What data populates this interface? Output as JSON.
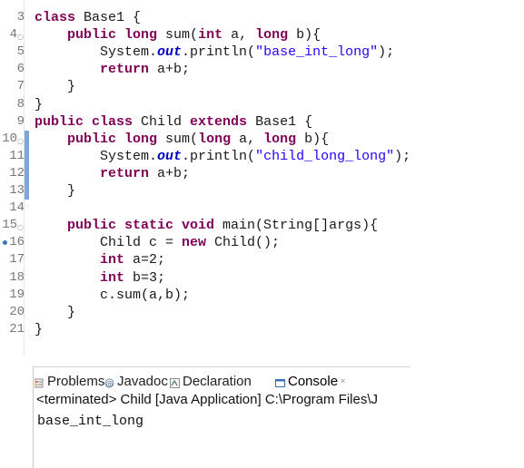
{
  "editor": {
    "lines": [
      {
        "num": "3",
        "segments": [
          [
            "kw",
            "class"
          ],
          [
            "",
            " Base1 {"
          ]
        ]
      },
      {
        "num": "4",
        "fold": true,
        "segments": [
          [
            "",
            "    "
          ],
          [
            "kw",
            "public long"
          ],
          [
            "",
            " sum("
          ],
          [
            "kw",
            "int"
          ],
          [
            "",
            " a, "
          ],
          [
            "kw",
            "long"
          ],
          [
            "",
            " b){"
          ]
        ]
      },
      {
        "num": "5",
        "segments": [
          [
            "",
            "        System."
          ],
          [
            "fld",
            "out"
          ],
          [
            "",
            ".println("
          ],
          [
            "str",
            "\"base_int_long\""
          ],
          [
            "",
            ");"
          ]
        ]
      },
      {
        "num": "6",
        "segments": [
          [
            "",
            "        "
          ],
          [
            "kw",
            "return"
          ],
          [
            "",
            " a+b;"
          ]
        ]
      },
      {
        "num": "7",
        "segments": [
          [
            "",
            "    }"
          ]
        ]
      },
      {
        "num": "8",
        "segments": [
          [
            "",
            "}"
          ]
        ]
      },
      {
        "num": "9",
        "segments": [
          [
            "kw",
            "public class"
          ],
          [
            "",
            " Child "
          ],
          [
            "kw",
            "extends"
          ],
          [
            "",
            " Base1 {"
          ]
        ]
      },
      {
        "num": "10",
        "fold": true,
        "changed": true,
        "segments": [
          [
            "",
            "    "
          ],
          [
            "kw",
            "public long"
          ],
          [
            "",
            " sum("
          ],
          [
            "kw",
            "long"
          ],
          [
            "",
            " a, "
          ],
          [
            "kw",
            "long"
          ],
          [
            "",
            " b){"
          ]
        ]
      },
      {
        "num": "11",
        "changed": true,
        "segments": [
          [
            "",
            "        System."
          ],
          [
            "fld",
            "out"
          ],
          [
            "",
            ".println("
          ],
          [
            "str",
            "\"child_long_long\""
          ],
          [
            "",
            ");"
          ]
        ]
      },
      {
        "num": "12",
        "changed": true,
        "segments": [
          [
            "",
            "        "
          ],
          [
            "kw",
            "return"
          ],
          [
            "",
            " a+b;"
          ]
        ]
      },
      {
        "num": "13",
        "changed": true,
        "segments": [
          [
            "",
            "    }"
          ]
        ]
      },
      {
        "num": "14",
        "segments": [
          [
            "",
            ""
          ]
        ]
      },
      {
        "num": "15",
        "fold": true,
        "segments": [
          [
            "",
            "    "
          ],
          [
            "kw",
            "public static void"
          ],
          [
            "",
            " main(String[]args){"
          ]
        ]
      },
      {
        "num": "16",
        "bookmark": true,
        "segments": [
          [
            "",
            "        Child c = "
          ],
          [
            "kw",
            "new"
          ],
          [
            "",
            " Child();"
          ]
        ]
      },
      {
        "num": "17",
        "segments": [
          [
            "",
            "        "
          ],
          [
            "kw",
            "int"
          ],
          [
            "",
            " a=2;"
          ]
        ]
      },
      {
        "num": "18",
        "segments": [
          [
            "",
            "        "
          ],
          [
            "kw",
            "int"
          ],
          [
            "",
            " b=3;"
          ]
        ]
      },
      {
        "num": "19",
        "segments": [
          [
            "",
            "        c.sum(a,b);"
          ]
        ]
      },
      {
        "num": "20",
        "segments": [
          [
            "",
            "    }"
          ]
        ]
      },
      {
        "num": "21",
        "segments": [
          [
            "",
            "}"
          ]
        ]
      }
    ]
  },
  "console_view": {
    "tabs": [
      {
        "label": "Problems",
        "icon": "problems-icon"
      },
      {
        "label": "Javadoc",
        "icon": "javadoc-icon"
      },
      {
        "label": "Declaration",
        "icon": "declaration-icon"
      },
      {
        "label": "Console",
        "icon": "console-icon",
        "active": true
      }
    ],
    "close_glyph": "×",
    "status": "<terminated> Child [Java Application] C:\\Program Files\\J",
    "output": "base_int_long"
  },
  "colors": {
    "keyword": "#7f0055",
    "static_field": "#0000c0",
    "string": "#2a00ff",
    "line_number": "#787878",
    "change_bar": "#7ea7d8"
  }
}
